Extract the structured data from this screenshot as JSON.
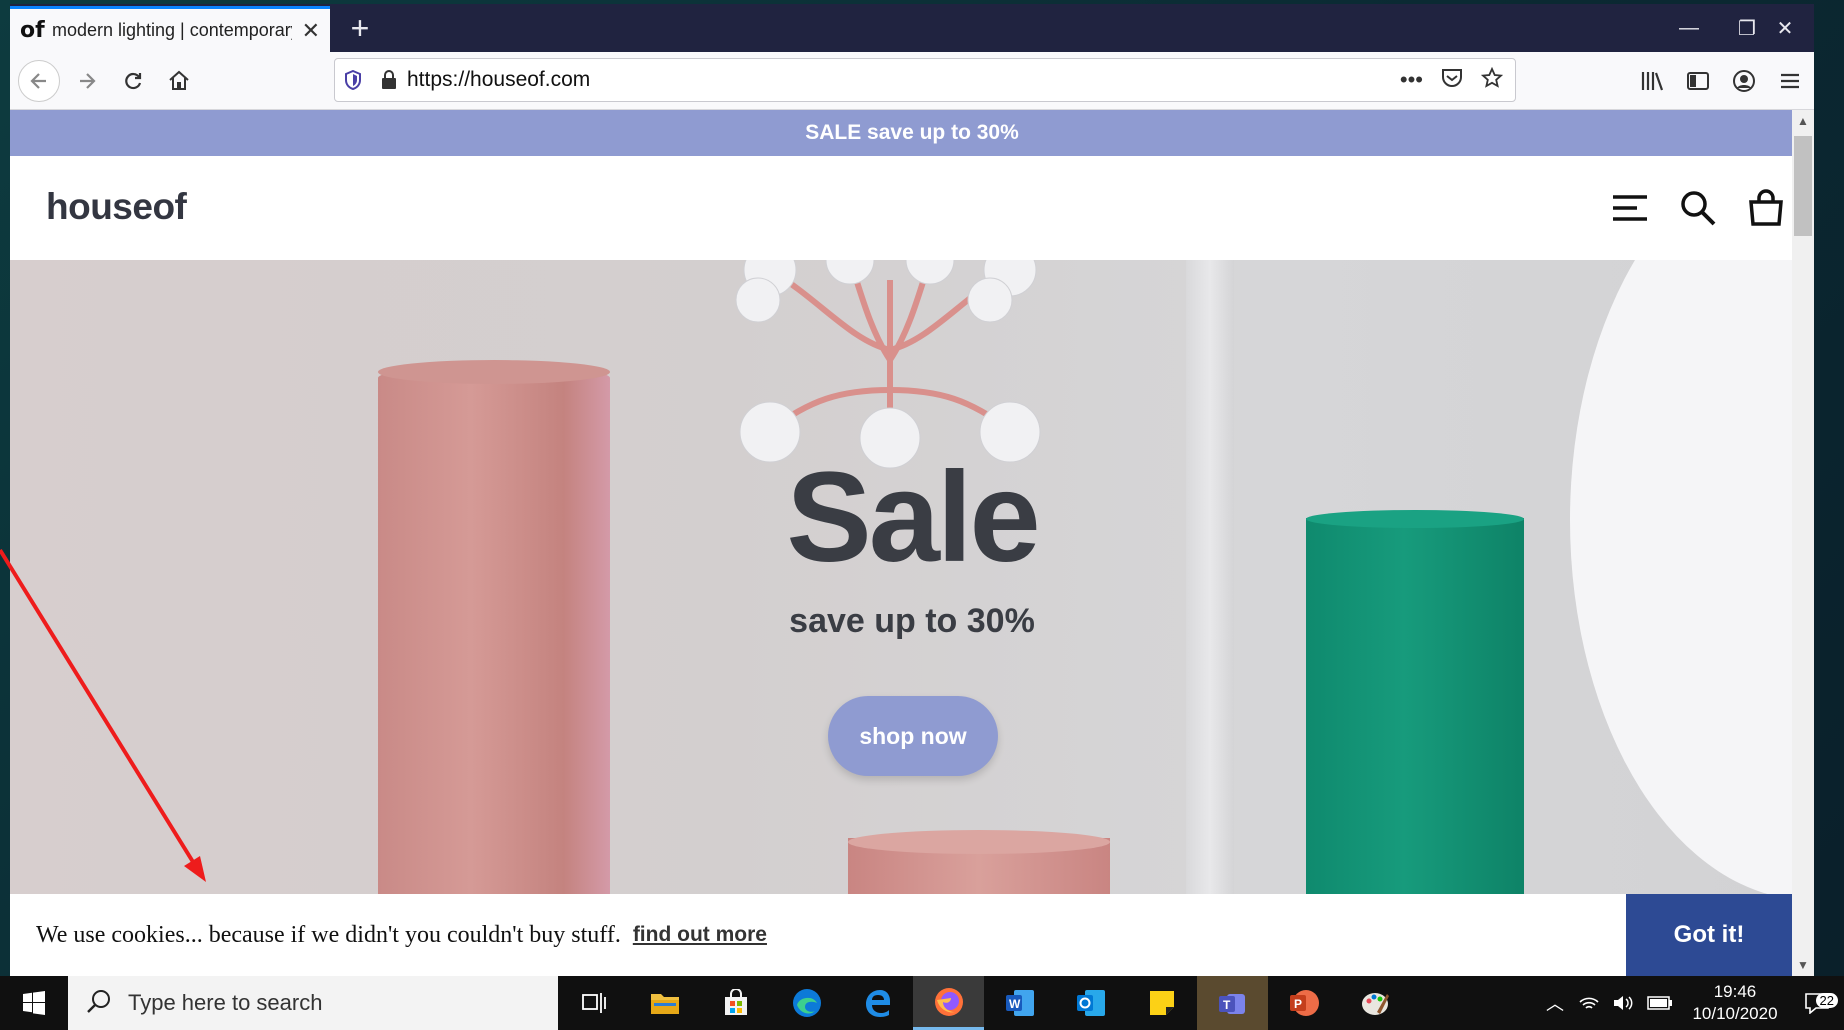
{
  "browser": {
    "tab": {
      "favicon_text": "of",
      "title": "modern lighting | contemporary"
    },
    "url": "https://houseof.com"
  },
  "site": {
    "promo_banner": "SALE save up to 30%",
    "logo": "houseof",
    "hero": {
      "title": "Sale",
      "subtitle": "save up to 30%",
      "cta": "shop now"
    },
    "cookie": {
      "message": "We use cookies... because if we didn't you couldn't buy stuff.",
      "link": "find out more",
      "button": "Got it!"
    }
  },
  "taskbar": {
    "search_placeholder": "Type here to search",
    "time": "19:46",
    "date": "10/10/2020",
    "notification_count": "22"
  },
  "colors": {
    "accent": "#8f9bd1",
    "cookie_button": "#2d4a94",
    "tab_bar": "#202340"
  }
}
